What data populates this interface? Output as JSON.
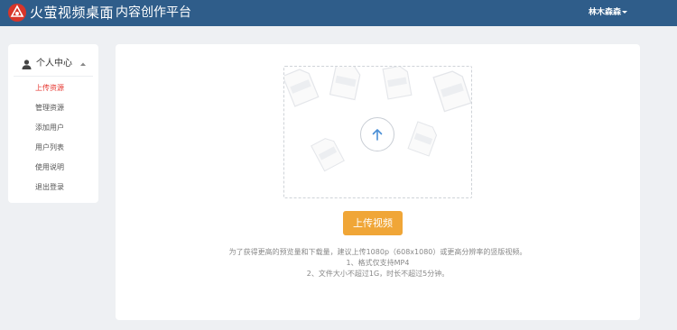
{
  "header": {
    "brand": "火萤视频桌面",
    "subtitle": "内容创作平台",
    "user": "林木森森"
  },
  "sidebar": {
    "section_label": "个人中心",
    "items": [
      {
        "label": "上传资源",
        "active": true
      },
      {
        "label": "管理资源",
        "active": false
      },
      {
        "label": "添加用户",
        "active": false
      },
      {
        "label": "用户列表",
        "active": false
      },
      {
        "label": "使用说明",
        "active": false
      },
      {
        "label": "退出登录",
        "active": false
      }
    ]
  },
  "upload": {
    "button_label": "上传视频",
    "tips": [
      "为了获得更高的预览量和下载量，建议上传1080p（608x1080）或更高分辨率的竖版视频。",
      "1、格式仅支持MP4",
      "2、文件大小不超过1G，时长不超过5分钟。"
    ],
    "file_tag": "MP4"
  },
  "colors": {
    "header_bg": "#2f5d8a",
    "accent": "#f0a637",
    "active_nav": "#e6362f"
  }
}
